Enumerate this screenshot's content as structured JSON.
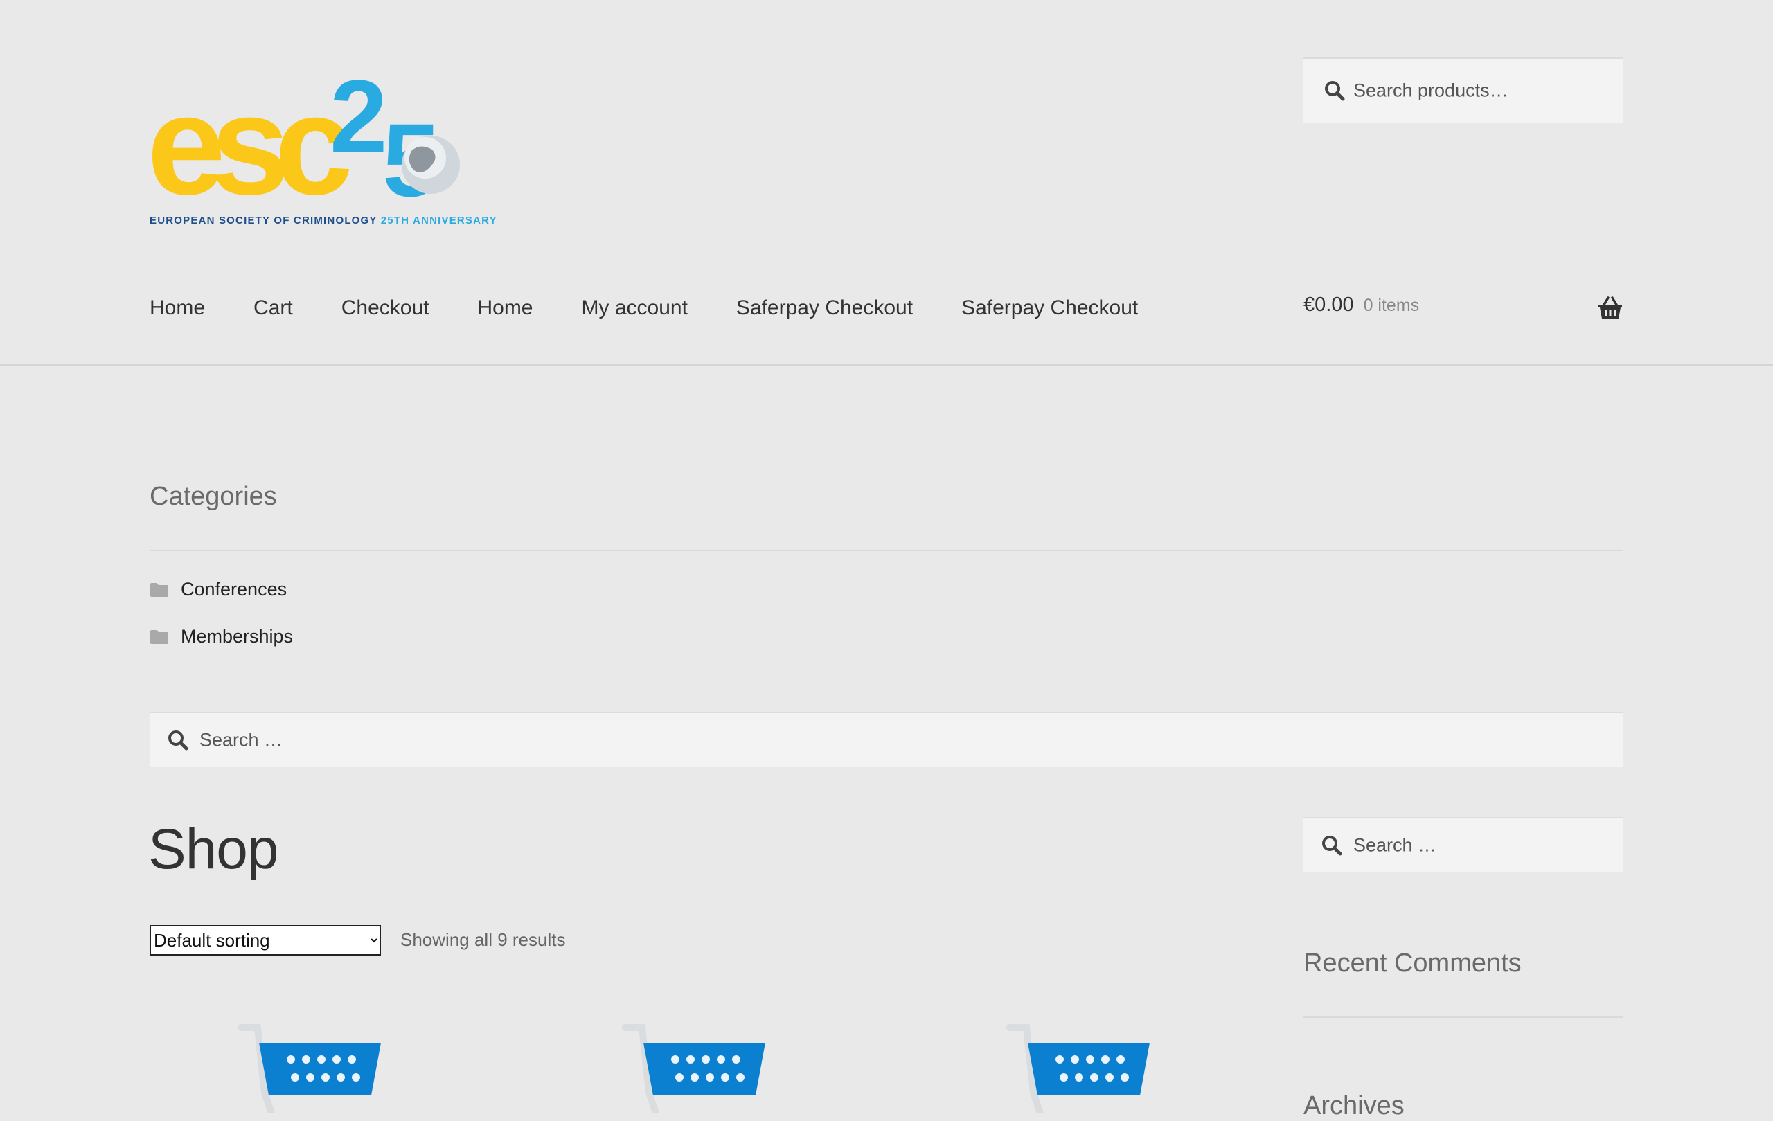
{
  "header": {
    "logo_tagline": "EUROPEAN SOCIETY OF CRIMINOLOGY",
    "logo_tagline_accent": "25TH ANNIVERSARY",
    "search_placeholder": "Search products…",
    "nav": [
      "Home",
      "Cart",
      "Checkout",
      "Home",
      "My account",
      "Saferpay Checkout",
      "Saferpay Checkout"
    ],
    "cart_total": "€0.00",
    "cart_count": "0 items"
  },
  "categories": {
    "title": "Categories",
    "items": [
      "Conferences",
      "Memberships"
    ]
  },
  "content_search": {
    "placeholder": "Search …"
  },
  "shop": {
    "title": "Shop",
    "sort_selected": "Default sorting",
    "result_count": "Showing all 9 results"
  },
  "sidebar": {
    "search_placeholder": "Search …",
    "recent_comments_title": "Recent Comments",
    "archives_title": "Archives"
  },
  "colors": {
    "background": "#e9e9e9",
    "logo_yellow": "#fbc81a",
    "logo_blue": "#29abe2",
    "cart_blue": "#0b80d1"
  }
}
